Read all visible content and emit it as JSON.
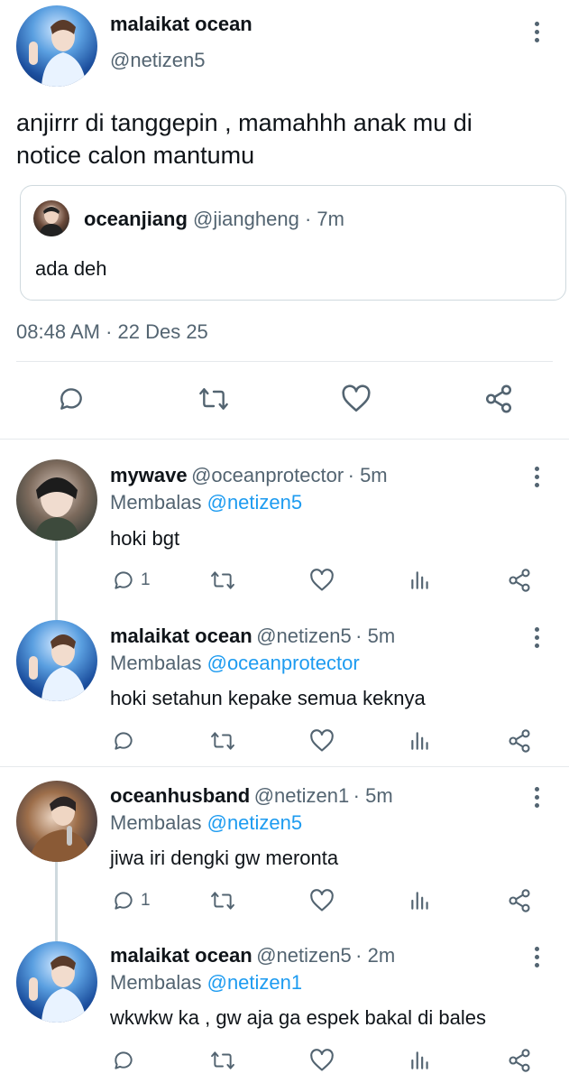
{
  "main_tweet": {
    "name": "malaikat ocean",
    "handle": "@netizen5",
    "text_line1": "anjirrr di tanggepin , mamahhh anak mu di",
    "text_line2": "notice calon mantumu",
    "quote": {
      "name": "oceanjiang",
      "handle": "@jiangheng",
      "time": "· 7m",
      "text": "ada deh"
    },
    "timestamp": "08:48 AM · 22 Des 25"
  },
  "replies": [
    {
      "name": "mywave",
      "handle": "@oceanprotector",
      "time": "· 5m",
      "replying_label": "Membalas",
      "replying_to": "@netizen5",
      "text": "hoki bgt",
      "reply_count": "1"
    },
    {
      "name": "malaikat ocean",
      "handle": "@netizen5",
      "time": "· 5m",
      "replying_label": "Membalas",
      "replying_to": "@oceanprotector",
      "text": "hoki setahun kepake semua keknya",
      "reply_count": ""
    },
    {
      "name": "oceanhusband",
      "handle": "@netizen1",
      "time": "· 5m",
      "replying_label": "Membalas",
      "replying_to": "@netizen5",
      "text": "jiwa iri dengki gw meronta",
      "reply_count": "1"
    },
    {
      "name": "malaikat ocean",
      "handle": "@netizen5",
      "time": "· 2m",
      "replying_label": "Membalas",
      "replying_to": "@netizen1",
      "text": "wkwkw ka , gw aja ga espek bakal di bales",
      "reply_count": ""
    }
  ],
  "colors": {
    "accent": "#1d9bf0",
    "secondary_text": "#536471",
    "divider": "#e6e9ec"
  },
  "icons": [
    "more-icon",
    "reply-icon",
    "retweet-icon",
    "like-icon",
    "views-icon",
    "share-icon"
  ]
}
